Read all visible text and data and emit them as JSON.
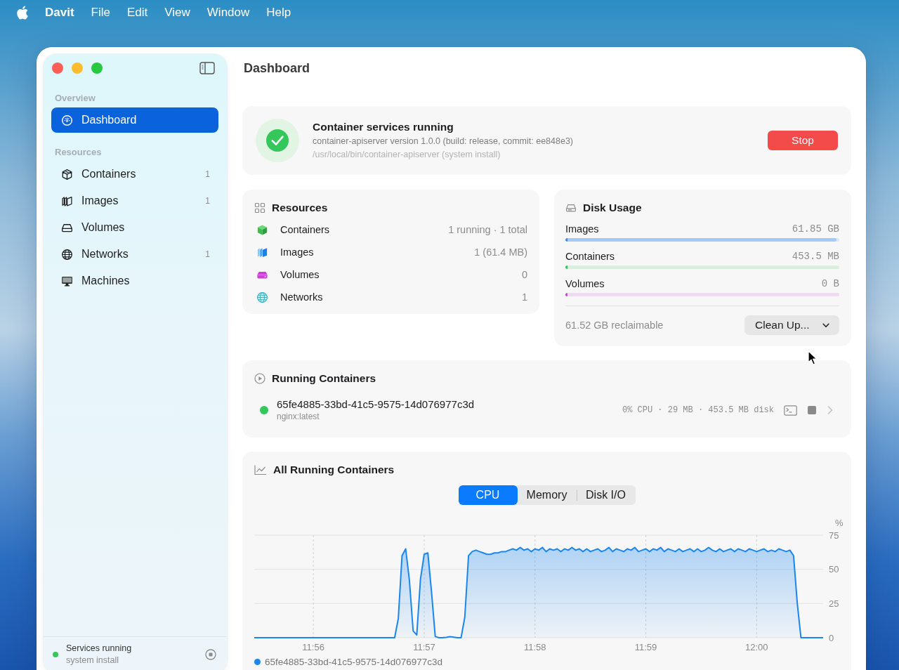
{
  "menu_bar": {
    "app_name": "Davit",
    "items": [
      "File",
      "Edit",
      "View",
      "Window",
      "Help"
    ]
  },
  "sidebar": {
    "sections": [
      {
        "title": "Overview",
        "items": [
          {
            "label": "Dashboard",
            "selected": true
          }
        ]
      },
      {
        "title": "Resources",
        "items": [
          {
            "label": "Containers",
            "count": "1",
            "selected": false
          },
          {
            "label": "Images",
            "count": "1",
            "selected": false
          },
          {
            "label": "Volumes",
            "selected": false
          },
          {
            "label": "Networks",
            "count": "1",
            "selected": false
          },
          {
            "label": "Machines",
            "selected": false
          }
        ]
      }
    ],
    "footer": {
      "status": "Services running",
      "detail": "system install",
      "running": true
    }
  },
  "page_title": "Dashboard",
  "service_status": {
    "title": "Container services running",
    "version": "container-apiserver version 1.0.0 (build: release, commit: ee848e3)",
    "path": "/usr/local/bin/container-apiserver (system install)",
    "action": "Stop"
  },
  "resources": {
    "title": "Resources",
    "rows": [
      {
        "label": "Containers",
        "value": "1 running · 1 total"
      },
      {
        "label": "Images",
        "value": "1 (61.4 MB)"
      },
      {
        "label": "Volumes",
        "value": "0"
      },
      {
        "label": "Networks",
        "value": "1"
      }
    ]
  },
  "disk_usage": {
    "title": "Disk Usage",
    "rows": [
      {
        "label": "Images",
        "value": "61.85 GB",
        "level": 0.99,
        "color": "#2f8ef0"
      },
      {
        "label": "Containers",
        "value": "453.5 MB",
        "level": 0.01,
        "color": "#34c759"
      },
      {
        "label": "Volumes",
        "value": "0 B",
        "level": 0,
        "color": "#c542d8"
      }
    ],
    "reclaimable": "61.52 GB reclaimable",
    "action": "Clean Up..."
  },
  "running_containers": {
    "title": "Running Containers",
    "items": [
      {
        "id": "65fe4885-33bd-41c5-9575-14d076977c3d",
        "image": "nginx:latest",
        "stats": "0% CPU · 29 MB · 453.5 MB disk",
        "running": true
      }
    ]
  },
  "activity": {
    "title": "All Running Containers",
    "tabs": [
      {
        "label": "CPU",
        "selected": true
      },
      {
        "label": "Memory",
        "selected": false
      },
      {
        "label": "Disk I/O",
        "selected": false
      }
    ],
    "chart_data": {
      "type": "area",
      "ylabel": "%",
      "categories": [
        null,
        null,
        null,
        null,
        null,
        null,
        null,
        null,
        null,
        null,
        null,
        null,
        null,
        null,
        null,
        null,
        "11:56",
        null,
        null,
        null,
        null,
        null,
        null,
        null,
        null,
        null,
        null,
        null,
        null,
        null,
        null,
        null,
        null,
        null,
        null,
        null,
        null,
        null,
        null,
        null,
        null,
        null,
        null,
        null,
        null,
        null,
        "11:57",
        null,
        null,
        null,
        null,
        null,
        null,
        null,
        null,
        null,
        null,
        null,
        null,
        null,
        null,
        null,
        null,
        null,
        null,
        null,
        null,
        null,
        null,
        null,
        null,
        null,
        null,
        null,
        null,
        null,
        "11:58",
        null,
        null,
        null,
        null,
        null,
        null,
        null,
        null,
        null,
        null,
        null,
        null,
        null,
        null,
        null,
        null,
        null,
        null,
        null,
        null,
        null,
        null,
        null,
        null,
        null,
        null,
        null,
        null,
        null,
        "11:59",
        null,
        null,
        null,
        null,
        null,
        null,
        null,
        null,
        null,
        null,
        null,
        null,
        null,
        null,
        null,
        null,
        null,
        null,
        null,
        null,
        null,
        null,
        null,
        null,
        null,
        null,
        null,
        null,
        null,
        "12:00",
        null,
        null,
        null,
        null,
        null,
        null,
        null,
        null,
        null,
        null,
        null,
        null,
        null,
        null,
        null,
        null,
        null,
        null
      ],
      "series": [
        {
          "name": "65fe4885-33bd-41c5-9575-14d076977c3d",
          "color": "#1a86ee",
          "values": [
            0,
            0,
            0,
            0,
            0,
            0,
            0,
            0,
            0,
            0,
            0,
            0,
            0,
            0,
            0,
            0,
            0,
            0,
            0,
            0,
            0,
            0,
            0,
            0,
            0,
            0,
            0,
            0,
            0,
            0,
            0,
            0,
            0,
            0,
            0,
            0,
            0,
            0,
            0,
            14,
            60,
            65,
            42,
            5,
            2,
            43,
            61,
            62,
            33,
            0.8,
            0,
            0,
            0.3,
            0.7,
            0.4,
            0,
            0,
            15,
            60,
            63,
            64,
            63,
            62,
            61,
            61,
            62,
            62,
            63,
            63,
            64,
            65,
            64,
            66,
            64,
            65,
            63,
            65,
            64,
            66,
            63,
            65,
            64,
            65,
            63,
            65,
            64,
            66,
            64,
            65,
            63,
            65,
            63,
            64,
            65,
            63,
            64,
            66,
            63,
            65,
            64,
            63,
            65,
            64,
            66,
            63,
            64,
            65,
            63,
            65,
            64,
            66,
            63,
            65,
            64,
            63,
            65,
            63,
            64,
            65,
            63,
            65,
            63,
            64,
            66,
            64,
            63,
            65,
            63,
            64,
            65,
            63,
            65,
            64,
            63,
            65,
            64,
            63,
            64,
            65,
            63,
            64,
            63,
            65,
            64,
            63,
            64,
            60,
            25,
            0,
            0,
            0,
            0,
            0,
            0,
            0
          ]
        }
      ],
      "ylim": [
        0,
        75
      ],
      "yticks": [
        0,
        25,
        50,
        75
      ]
    }
  }
}
